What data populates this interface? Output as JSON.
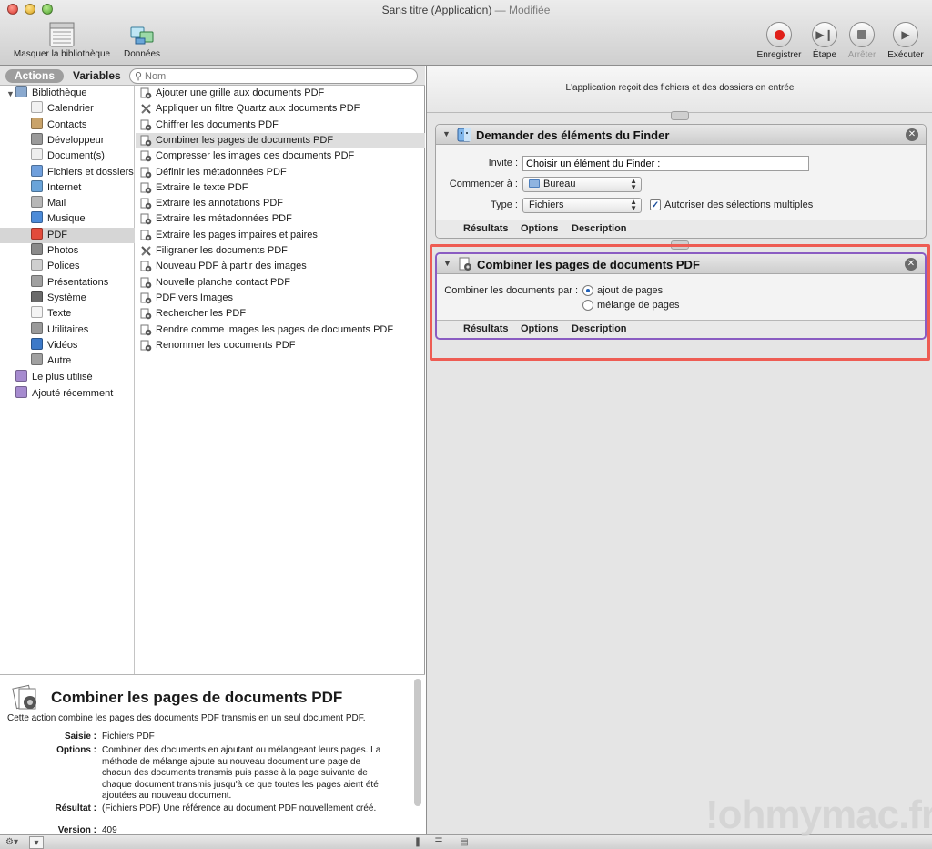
{
  "window": {
    "title": "Sans titre (Application)",
    "status": " — Modifiée"
  },
  "toolbar": {
    "hide_library": "Masquer la bibliothèque",
    "data": "Données",
    "record": "Enregistrer",
    "step": "Étape",
    "stop": "Arrêter",
    "run": "Exécuter"
  },
  "library": {
    "actions_tab": "Actions",
    "variables_tab": "Variables",
    "search_placeholder": "Nom",
    "categories": [
      {
        "label": "Bibliothèque",
        "icon": "library-icon"
      },
      {
        "label": "Calendrier",
        "icon": "calendar-icon"
      },
      {
        "label": "Contacts",
        "icon": "contacts-icon"
      },
      {
        "label": "Développeur",
        "icon": "developer-icon"
      },
      {
        "label": "Document(s)",
        "icon": "documents-icon"
      },
      {
        "label": "Fichiers et dossiers",
        "icon": "files-folders-icon"
      },
      {
        "label": "Internet",
        "icon": "internet-icon"
      },
      {
        "label": "Mail",
        "icon": "mail-icon"
      },
      {
        "label": "Musique",
        "icon": "music-icon"
      },
      {
        "label": "PDF",
        "icon": "pdf-icon"
      },
      {
        "label": "Photos",
        "icon": "photos-icon"
      },
      {
        "label": "Polices",
        "icon": "fonts-icon"
      },
      {
        "label": "Présentations",
        "icon": "presentations-icon"
      },
      {
        "label": "Système",
        "icon": "system-icon"
      },
      {
        "label": "Texte",
        "icon": "text-icon"
      },
      {
        "label": "Utilitaires",
        "icon": "utilities-icon"
      },
      {
        "label": "Vidéos",
        "icon": "videos-icon"
      },
      {
        "label": "Autre",
        "icon": "other-icon"
      },
      {
        "label": "Le plus utilisé",
        "icon": "folder-icon"
      },
      {
        "label": "Ajouté récemment",
        "icon": "folder-icon"
      }
    ],
    "selected_category": "PDF",
    "actions": [
      "Ajouter une grille aux documents PDF",
      "Appliquer un filtre Quartz aux documents PDF",
      "Chiffrer les documents PDF",
      "Combiner les pages de documents PDF",
      "Compresser les images des documents PDF",
      "Définir les métadonnées PDF",
      "Extraire le texte PDF",
      "Extraire les annotations PDF",
      "Extraire les métadonnées PDF",
      "Extraire les pages impaires et paires",
      "Filigraner les documents PDF",
      "Nouveau PDF à partir des images",
      "Nouvelle planche contact PDF",
      "PDF vers Images",
      "Rechercher les PDF",
      "Rendre comme images les pages de documents PDF",
      "Renommer les documents PDF"
    ],
    "selected_action": "Combiner les pages de documents PDF"
  },
  "description": {
    "title": "Combiner les pages de documents PDF",
    "summary": "Cette action combine les pages des documents PDF transmis en un seul document PDF.",
    "input_label": "Saisie :",
    "input_value": "Fichiers PDF",
    "options_label": "Options :",
    "options_lines": [
      "Combiner des documents en ajoutant ou mélangeant leurs pages. La",
      "méthode de mélange ajoute au nouveau document une page de",
      "chacun des documents transmis puis passe à la page suivante de",
      "chaque document transmis jusqu'à ce que toutes les pages aient été",
      "ajoutées au nouveau document."
    ],
    "result_label": "Résultat :",
    "result_value": "(Fichiers PDF) Une référence au document PDF nouvellement créé.",
    "version_label": "Version :",
    "version_value": "409"
  },
  "workflow": {
    "input_banner": "L'application reçoit des fichiers et des dossiers en entrée",
    "action1": {
      "title": "Demander des éléments du Finder",
      "prompt_label": "Invite :",
      "prompt_value": "Choisir un élément du Finder :",
      "start_label": "Commencer à :",
      "start_value": "Bureau",
      "type_label": "Type :",
      "type_value": "Fichiers",
      "multiple_label": "Autoriser des sélections multiples",
      "multiple_checked": true
    },
    "action2": {
      "title": "Combiner les pages de documents PDF",
      "combine_label": "Combiner les documents par :",
      "option_append": "ajout de pages",
      "option_shuffle": "mélange de pages",
      "selected": "ajout de pages"
    },
    "footer_tabs": [
      "Résultats",
      "Options",
      "Description"
    ]
  },
  "watermark": "!ohmymac.fr",
  "colors": {
    "highlight": "#ee5c53",
    "selection_border": "#8a5cc2",
    "record_red": "#e0201a"
  }
}
